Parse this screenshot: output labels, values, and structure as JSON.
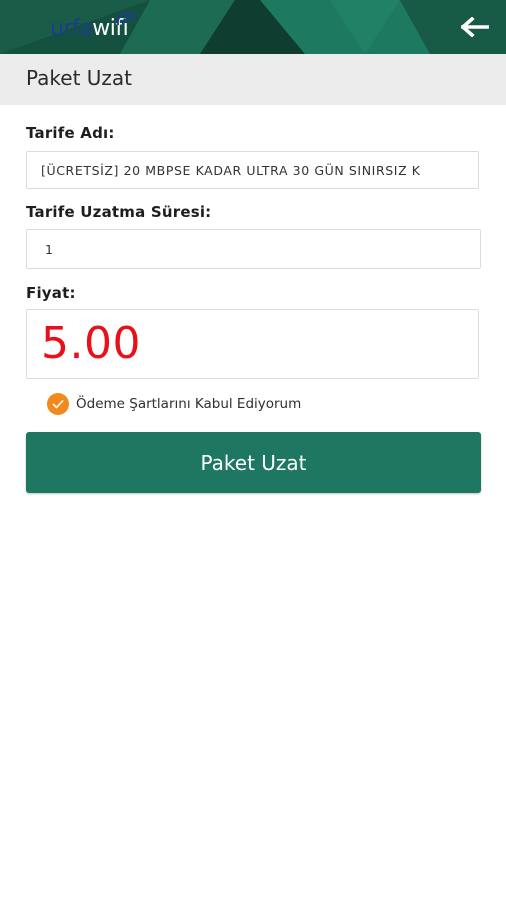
{
  "header": {
    "logo_part1": "urfa",
    "logo_part2": "wifi",
    "back_icon": "arrow-left-icon",
    "colors": {
      "bar": "#14503e",
      "accent": "#1e7761"
    }
  },
  "page": {
    "title": "Paket Uzat"
  },
  "form": {
    "tariff_label": "Tarife Adı:",
    "tariff_value": "[ÜCRETSİZ] 20 MBPSE KADAR ULTRA 30 GÜN SINIRSIZ K",
    "duration_label": "Tarife Uzatma Süresi:",
    "duration_value": "1",
    "price_label": "Fiyat:",
    "price_value": "5.00",
    "price_color": "#e8111b",
    "terms_text": "Ödeme Şartlarını Kabul Ediyorum",
    "terms_checked": true,
    "checkbox_color": "#f18a1c",
    "submit_label": "Paket Uzat"
  }
}
